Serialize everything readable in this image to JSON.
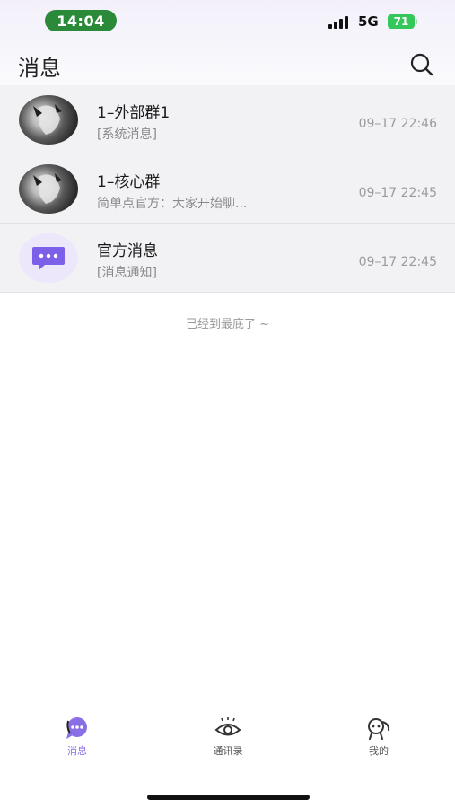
{
  "status_bar": {
    "time": "14:04",
    "network": "5G",
    "battery": "71"
  },
  "header": {
    "title": "消息",
    "search_icon": "search-icon"
  },
  "conversations": [
    {
      "title": "1–外部群1",
      "subtitle": "[系统消息]",
      "time": "09–17 22:46",
      "avatar": "dark-portrait"
    },
    {
      "title": "1–核心群",
      "subtitle": "简单点官方：大家开始聊...",
      "time": "09–17 22:45",
      "avatar": "dark-portrait"
    },
    {
      "title": "官方消息",
      "subtitle": "[消息通知]",
      "time": "09–17 22:45",
      "avatar": "chat-bubble-icon"
    }
  ],
  "end_hint": "已经到最底了 ~",
  "tabbar": {
    "tabs": [
      {
        "label": "消息",
        "icon": "message-icon",
        "active": true
      },
      {
        "label": "通讯录",
        "icon": "eye-icon",
        "active": false
      },
      {
        "label": "我的",
        "icon": "profile-icon",
        "active": false
      }
    ]
  },
  "colors": {
    "accent": "#8a6ee6",
    "time_pill": "#2a8a3a",
    "battery": "#34c759",
    "row_bg": "#f2f2f4"
  }
}
